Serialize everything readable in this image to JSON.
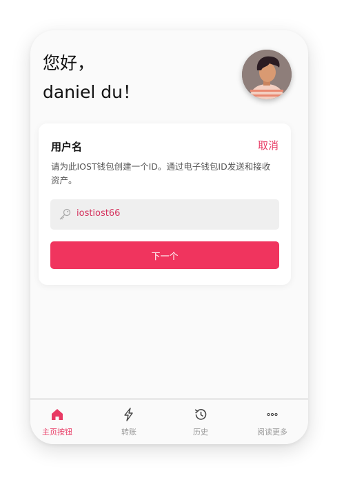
{
  "greeting": {
    "hello": "您好，",
    "name": "daniel du！"
  },
  "avatar": {
    "alt": "user-avatar"
  },
  "card": {
    "title": "用户名",
    "cancel_label": "取消",
    "description": "请为此IOST钱包创建一个ID。通过电子钱包ID发送和接收资产。",
    "username_value": "iostiost66",
    "next_label": "下一个"
  },
  "tabbar": {
    "items": [
      {
        "label": "主页按钮",
        "icon": "home-icon",
        "active": true
      },
      {
        "label": "转账",
        "icon": "lightning-icon",
        "active": false
      },
      {
        "label": "历史",
        "icon": "history-icon",
        "active": false
      },
      {
        "label": "阅读更多",
        "icon": "more-icon",
        "active": false
      }
    ]
  },
  "colors": {
    "accent": "#f0345e",
    "accent_text": "#e83a64",
    "muted": "#999999"
  }
}
